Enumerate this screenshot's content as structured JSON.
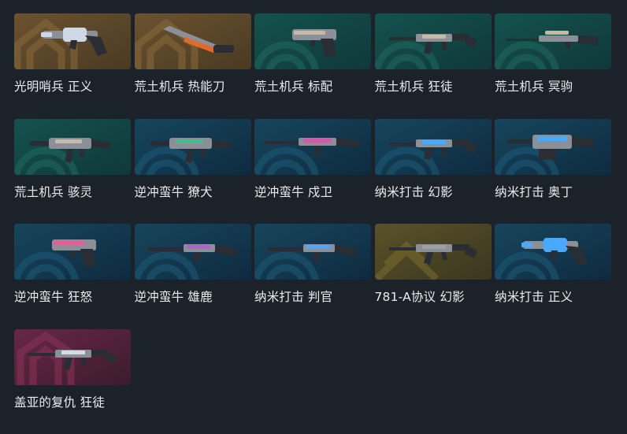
{
  "tier_colors": {
    "exclusive": {
      "base": "#4a3a22",
      "mid": "#6b5230",
      "emblem": "#8a6a3a"
    },
    "premium": {
      "base": "#10383a",
      "mid": "#14524e",
      "emblem": "#1f6b62"
    },
    "deluxe": {
      "base": "#0e2b40",
      "mid": "#17455c",
      "emblem": "#1e5c78"
    },
    "select": {
      "base": "#3b3620",
      "mid": "#5a5228",
      "emblem": "#7a6e30"
    },
    "ultra": {
      "base": "#3a1c2e",
      "mid": "#6a2648",
      "emblem": "#8a3358"
    }
  },
  "items": [
    {
      "label": "光明哨兵 正义",
      "tier": "exclusive",
      "icon": "revolver-icon",
      "accent": "#cfd8e6"
    },
    {
      "label": "荒土机兵 热能刀",
      "tier": "exclusive",
      "icon": "knife-icon",
      "accent": "#e06a2a"
    },
    {
      "label": "荒土机兵 标配",
      "tier": "premium",
      "icon": "pistol-icon",
      "accent": "#c8b8a8"
    },
    {
      "label": "荒土机兵 狂徒",
      "tier": "premium",
      "icon": "assault-rifle-icon",
      "accent": "#c8b8a8"
    },
    {
      "label": "荒土机兵 冥驹",
      "tier": "premium",
      "icon": "sniper-rifle-icon",
      "accent": "#c8b8a8"
    },
    {
      "label": "荒土机兵 骇灵",
      "tier": "premium",
      "icon": "smg-icon",
      "accent": "#c8b8a8"
    },
    {
      "label": "逆冲蛮牛 獠犬",
      "tier": "deluxe",
      "icon": "smg-icon",
      "accent": "#3fbf8a"
    },
    {
      "label": "逆冲蛮牛 戍卫",
      "tier": "deluxe",
      "icon": "rifle-icon",
      "accent": "#d05aa8"
    },
    {
      "label": "纳米打击 幻影",
      "tier": "deluxe",
      "icon": "assault-rifle-icon",
      "accent": "#4aa8ff"
    },
    {
      "label": "纳米打击 奥丁",
      "tier": "deluxe",
      "icon": "machine-gun-icon",
      "accent": "#4aa8ff"
    },
    {
      "label": "逆冲蛮牛 狂怒",
      "tier": "deluxe",
      "icon": "pistol-icon",
      "accent": "#e0609a"
    },
    {
      "label": "逆冲蛮牛 雄鹿",
      "tier": "deluxe",
      "icon": "shotgun-icon",
      "accent": "#b060d0"
    },
    {
      "label": "纳米打击 判官",
      "tier": "deluxe",
      "icon": "shotgun-icon",
      "accent": "#4aa8ff"
    },
    {
      "label": "781-A协议 幻影",
      "tier": "select",
      "icon": "assault-rifle-icon",
      "accent": "#9aa0a6"
    },
    {
      "label": "纳米打击 正义",
      "tier": "deluxe",
      "icon": "revolver-icon",
      "accent": "#4aa8ff"
    },
    {
      "label": "盖亚的复仇 狂徒",
      "tier": "ultra",
      "icon": "assault-rifle-icon",
      "accent": "#d8d8e8"
    }
  ]
}
